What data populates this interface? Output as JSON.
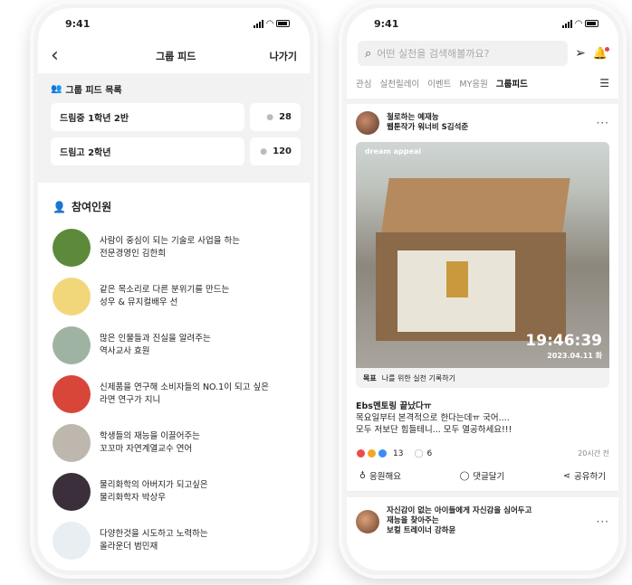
{
  "left": {
    "status_time": "9:41",
    "nav": {
      "title": "그룹 피드",
      "action": "나가기"
    },
    "group_list": {
      "heading": "그룹 피드 목록",
      "groups": [
        {
          "name": "드림중 1학년 2반",
          "count": "28"
        },
        {
          "name": "드림고 2학년",
          "count": "120"
        }
      ]
    },
    "members_heading": "참여인원",
    "members": [
      {
        "line1": "사람이 중심이 되는 기술로 사업을 하는",
        "line2": "전문경영인 김한희",
        "avatar_color": "#5c8a3a"
      },
      {
        "line1": "같은 목소리로 다른 분위기를 만드는",
        "line2": "성우 & 뮤지컬배우 선",
        "avatar_color": "#f2d77a"
      },
      {
        "line1": "많은 인물들과 진실을 알려주는",
        "line2": "역사교사 효원",
        "avatar_color": "#9fb3a3"
      },
      {
        "line1": "신제품을 연구해 소비자들의 NO.1이 되고 싶은",
        "line2": "라면 연구가 지니",
        "avatar_color": "#d8463a"
      },
      {
        "line1": "학생들의 재능을 이끌어주는",
        "line2": "꼬꼬마 자연계열교수 연어",
        "avatar_color": "#bdb7ae"
      },
      {
        "line1": "물리화학의 아버지가 되고싶은",
        "line2": "물리화학자 박상우",
        "avatar_color": "#3a2f3a"
      },
      {
        "line1": "다양한것을 시도하고 노력하는",
        "line2": "올라운더 범민재",
        "avatar_color": "#e8eef2"
      }
    ]
  },
  "right": {
    "status_time": "9:41",
    "search_placeholder": "어떤 실천을 검색해볼까요?",
    "tabs": [
      "관심",
      "실천릴레이",
      "이벤트",
      "MY응원",
      "그룹피드"
    ],
    "active_tab": "그룹피드",
    "post": {
      "author_line1": "철로하는 예재능",
      "author_line2": "웹툰작가 워너비 S김석준",
      "photo_watermark": "dream appeal",
      "photo_time": "19:46:39",
      "photo_date": "2023.04.11 화",
      "goal_label": "목표",
      "goal_text": "나를 위한 실천 기록하기",
      "title": "Ebs멘토링 끝났다ㅠ",
      "body_line1": "목요일부터 본격적으로 한다는데ㅠ 국어....",
      "body_line2": "모두 저보단 힘들테니... 모두 열공하세요!!!",
      "reactions": "13",
      "comments": "6",
      "time_ago": "20시간 전",
      "action_cheer": "응원해요",
      "action_comment": "댓글달기",
      "action_share": "공유하기"
    },
    "next_post": {
      "line1": "자신감이 없는 아이들에게 자신감을 심어두고",
      "line2": "재능을 찾아주는",
      "line3": "보컬 트레이너 강하윤"
    }
  }
}
